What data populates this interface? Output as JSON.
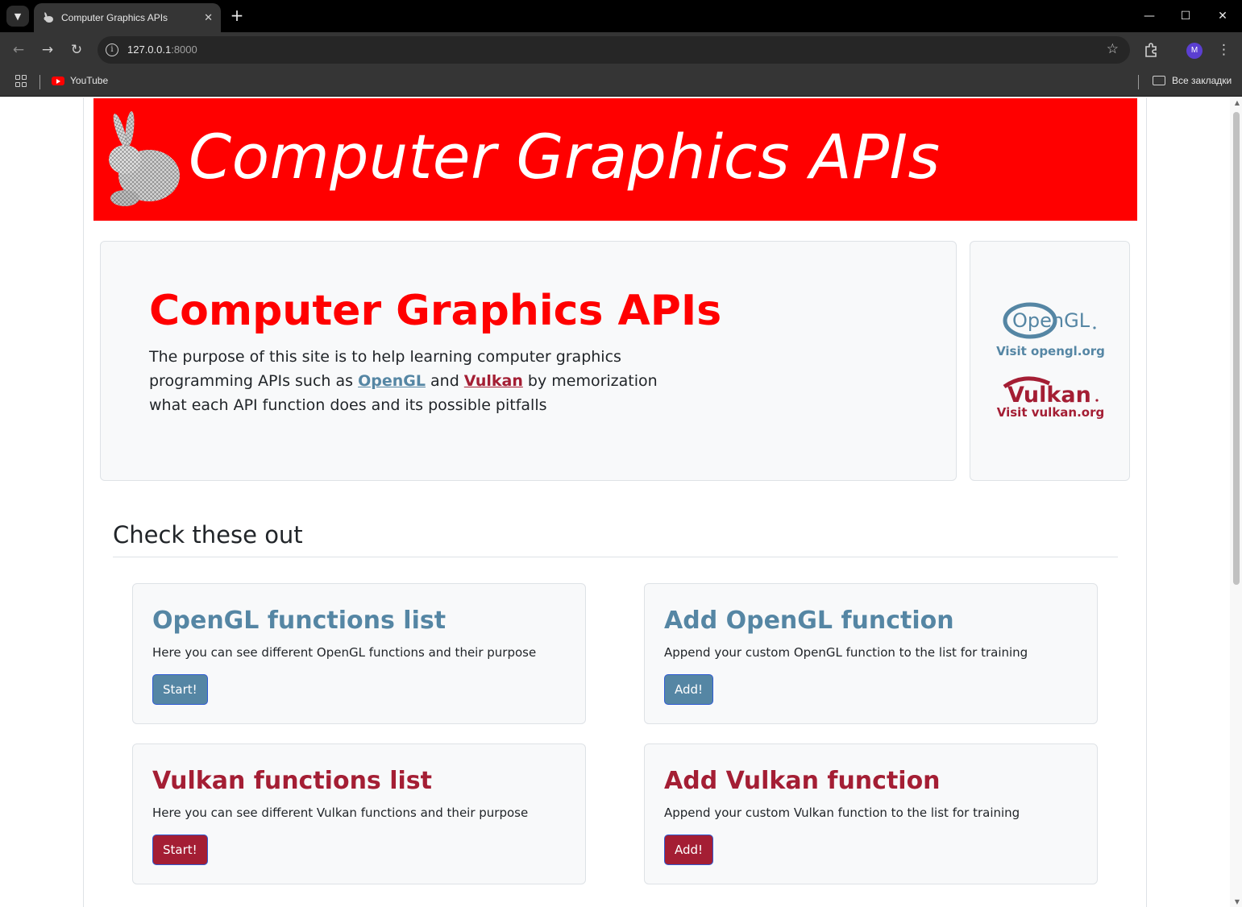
{
  "browser": {
    "tab_title": "Computer Graphics APIs",
    "url_host": "127.0.0.1",
    "url_port": ":8000",
    "profile_initial": "M",
    "bookmarks": [
      {
        "label": "YouTube",
        "icon": "youtube-icon"
      }
    ],
    "all_bookmarks_label": "Все закладки"
  },
  "banner": {
    "title": "Computer Graphics APIs",
    "logo_icon": "bunny-wireframe-icon",
    "background_color": "#ff0000"
  },
  "hero": {
    "title": "Computer Graphics APIs",
    "text_before": "The purpose of this site is to help learning computer graphics programming APIs such as ",
    "link_opengl": "OpenGL",
    "text_and": " and ",
    "link_vulkan": "Vulkan",
    "text_after": " by memorization what each API function does and its possible pitfalls"
  },
  "side": {
    "opengl_logo_text": "OpenGL",
    "opengl_link": "Visit opengl.org",
    "vulkan_logo_text": "Vulkan",
    "vulkan_link": "Visit vulkan.org",
    "opengl_color": "#5586a4",
    "vulkan_color": "#a41e34"
  },
  "section": {
    "title": "Check these out"
  },
  "cards": [
    {
      "title": "OpenGL functions list",
      "text": "Here you can see different OpenGL functions and their purpose",
      "button": "Start!"
    },
    {
      "title": "Add OpenGL function",
      "text": "Append your custom OpenGL function to the list for training",
      "button": "Add!"
    },
    {
      "title": "Vulkan functions list",
      "text": "Here you can see different Vulkan functions and their purpose",
      "button": "Start!"
    },
    {
      "title": "Add Vulkan function",
      "text": "Append your custom Vulkan function to the list for training",
      "button": "Add!"
    }
  ]
}
